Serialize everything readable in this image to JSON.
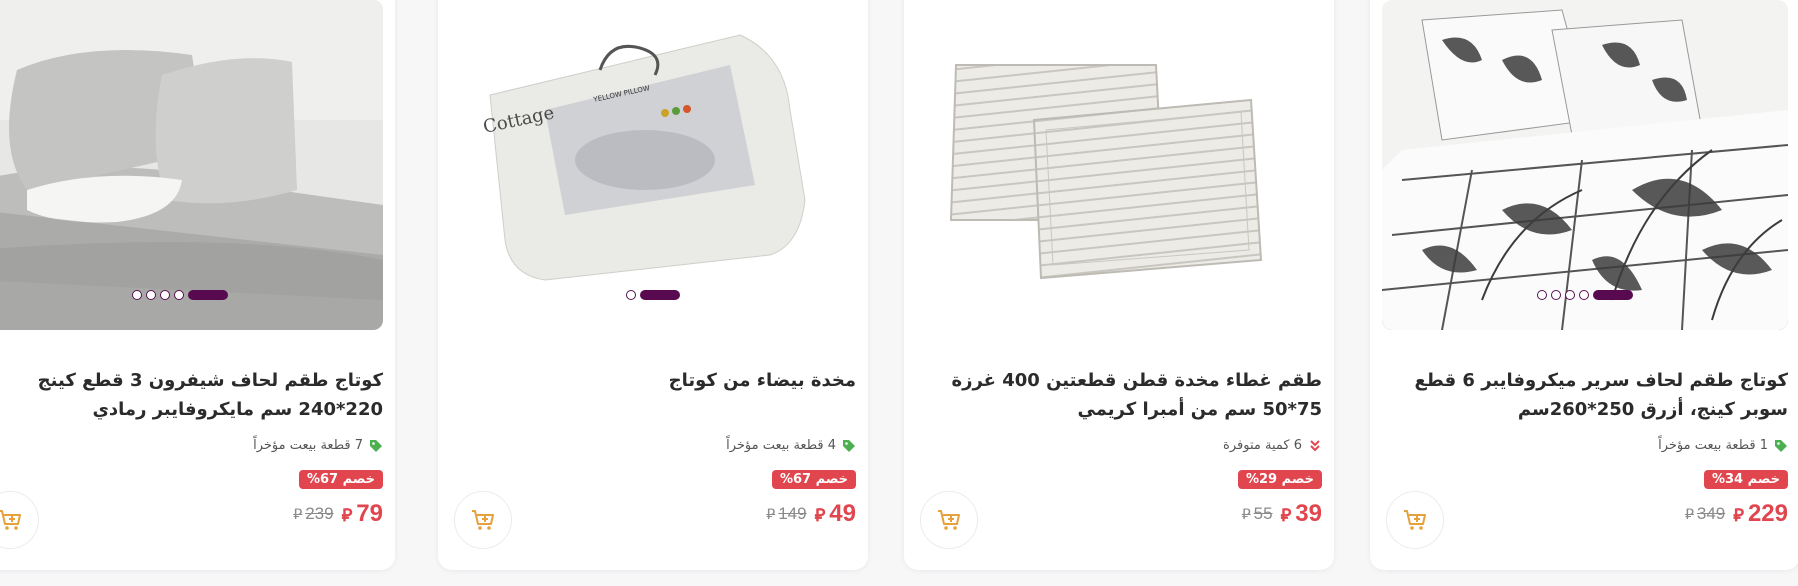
{
  "currency_symbol": "⃁",
  "products": [
    {
      "title": "كوتاج طقم لحاف شيفرون 3 قطع كينج 220*240 سم مايكروفايبر رمادي",
      "meta_text": "7 قطعة بيعت مؤخراً",
      "meta_icon": "tag-icon",
      "discount": "خصم 67%",
      "price": "79",
      "old_price": "239",
      "slides": 5,
      "active_slide": 4
    },
    {
      "title": "مخدة بيضاء من كوتاج",
      "meta_text": "4 قطعة بيعت مؤخراً",
      "meta_icon": "tag-icon",
      "discount": "خصم 67%",
      "price": "49",
      "old_price": "149",
      "slides": 2,
      "active_slide": 1,
      "package_brand": "Cottage",
      "package_label": "YELLOW PILLOW"
    },
    {
      "title": "طقم غطاء مخدة قطن قطعتين 400 غرزة 75*50 سم من أمبرا كريمي",
      "meta_text": "6 كمية متوفرة",
      "meta_icon": "double-chevron-down-icon",
      "discount": "خصم 29%",
      "price": "39",
      "old_price": "55",
      "slides": 0,
      "active_slide": 0
    },
    {
      "title": "كوتاج طقم لحاف سرير ميكروفايبر 6 قطع سوبر كينج، أزرق 250*260سم",
      "meta_text": "1 قطعة بيعت مؤخراً",
      "meta_icon": "tag-icon",
      "discount": "خصم 34%",
      "price": "229",
      "old_price": "349",
      "slides": 5,
      "active_slide": 4
    }
  ],
  "colors": {
    "price_red": "#e1464f",
    "accent_purple": "#58094f",
    "tag_green": "#4caf50",
    "stock_red": "#e1464f",
    "cart_orange": "#e6a03c"
  }
}
